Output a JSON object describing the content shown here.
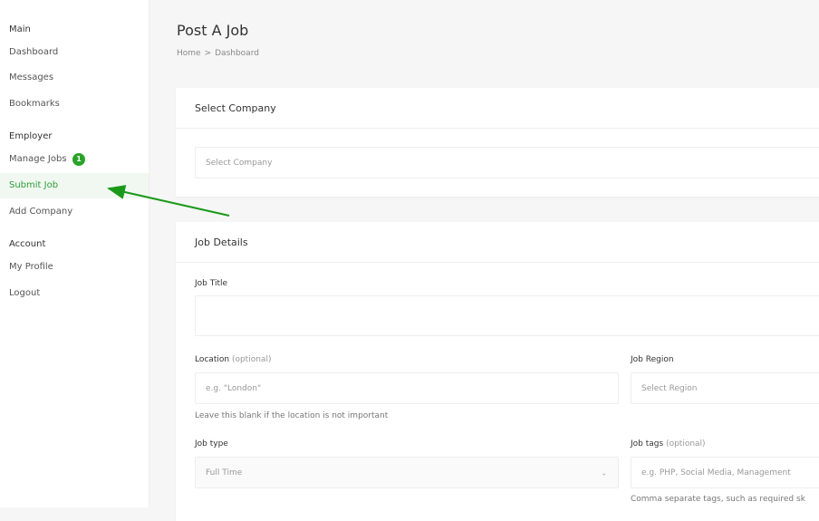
{
  "sidebar": {
    "groups": [
      {
        "title": "Main"
      },
      {
        "title": "Employer"
      },
      {
        "title": "Account"
      }
    ],
    "items": [
      {
        "label": "Dashboard"
      },
      {
        "label": "Messages"
      },
      {
        "label": "Bookmarks"
      },
      {
        "label": "Manage Jobs",
        "badge": "1"
      },
      {
        "label": "Submit Job"
      },
      {
        "label": "Add Company"
      },
      {
        "label": "My Profile"
      },
      {
        "label": "Logout"
      }
    ]
  },
  "header": {
    "title": "Post A Job",
    "breadcrumb": {
      "home": "Home",
      "separator": ">",
      "current": "Dashboard"
    }
  },
  "company_panel": {
    "title": "Select Company",
    "select_placeholder": "Select Company"
  },
  "job_panel": {
    "title": "Job Details",
    "job_title_label": "Job Title",
    "location_label": "Location",
    "location_optional": "(optional)",
    "location_placeholder": "e.g. \"London\"",
    "location_helper": "Leave this blank if the location is not important",
    "region_label": "Job Region",
    "region_placeholder": "Select Region",
    "job_type_label": "Job type",
    "job_type_value": "Full Time",
    "tags_label": "Job tags",
    "tags_optional": "(optional)",
    "tags_placeholder": "e.g. PHP, Social Media, Management",
    "tags_helper": "Comma separate tags, such as required sk"
  },
  "colors": {
    "accent": "#2e9e3a",
    "badge": "#29a329",
    "arrow": "#1a9a1a"
  }
}
